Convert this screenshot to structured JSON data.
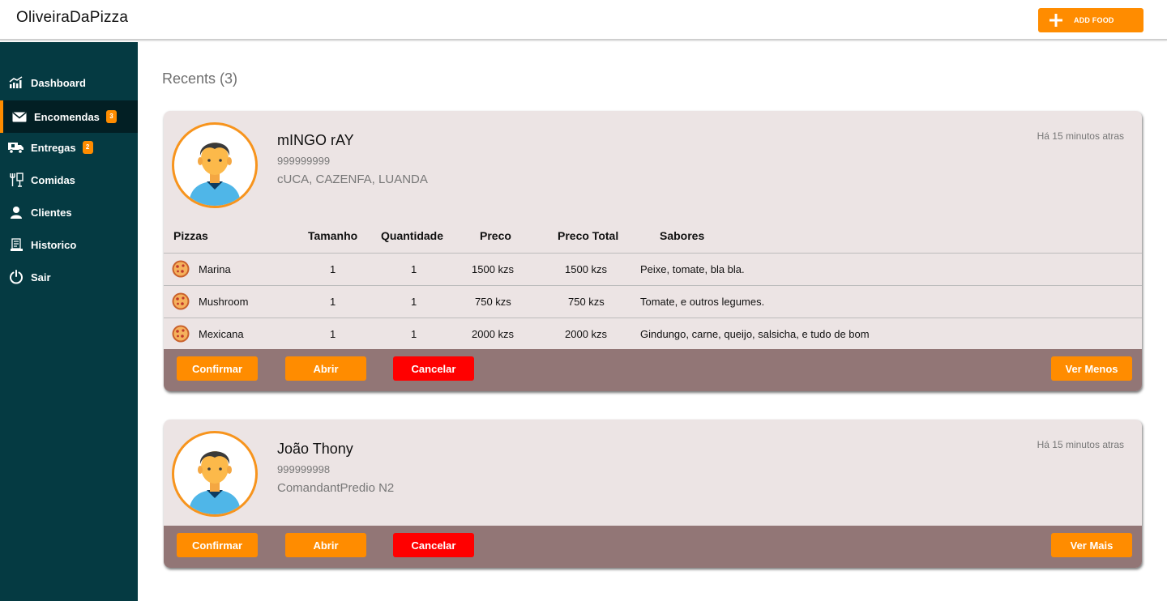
{
  "app": {
    "brand": "OliveiraDaPizza",
    "add_food_label": "ADD FOOD"
  },
  "sidebar": {
    "items": [
      {
        "label": "Dashboard",
        "icon": "chart-icon"
      },
      {
        "label": "Encomendas",
        "icon": "mail-icon",
        "badge": "3",
        "active": true
      },
      {
        "label": "Entregas",
        "icon": "truck-icon",
        "badge": "2"
      },
      {
        "label": "Comidas",
        "icon": "utensils-icon"
      },
      {
        "label": "Clientes",
        "icon": "user-icon"
      },
      {
        "label": "Historico",
        "icon": "history-icon"
      },
      {
        "label": "Sair",
        "icon": "power-icon"
      }
    ]
  },
  "main": {
    "title": "Recents (3)"
  },
  "orders": [
    {
      "name": "mINGO rAY",
      "phone": "999999999",
      "address": "cUCA, CAZENFA, LUANDA",
      "time": "Há 15 minutos atras",
      "columns": [
        "Pizzas",
        "Tamanho",
        "Quantidade",
        "Preco",
        "Preco Total",
        "Sabores"
      ],
      "items": [
        {
          "pizza": "Marina",
          "size": "1",
          "qty": "1",
          "price": "1500 kzs",
          "total": "1500 kzs",
          "flavors": "Peixe, tomate, bla bla."
        },
        {
          "pizza": "Mushroom",
          "size": "1",
          "qty": "1",
          "price": "750 kzs",
          "total": "750 kzs",
          "flavors": "Tomate, e outros legumes."
        },
        {
          "pizza": "Mexicana",
          "size": "1",
          "qty": "1",
          "price": "2000 kzs",
          "total": "2000 kzs",
          "flavors": "Gindungo, carne, queijo, salsicha, e tudo de bom"
        }
      ],
      "buttons": {
        "confirm": "Confirmar",
        "open": "Abrir",
        "cancel": "Cancelar",
        "toggle": "Ver Menos"
      }
    },
    {
      "name": "João Thony",
      "phone": "999999998",
      "address": "ComandantPredio N2",
      "time": "Há 15 minutos atras",
      "buttons": {
        "confirm": "Confirmar",
        "open": "Abrir",
        "cancel": "Cancelar",
        "toggle": "Ver Mais"
      }
    }
  ],
  "colors": {
    "accent": "#ff8c00",
    "sidebar": "#053a42",
    "card": "#ece4e4",
    "action_bar": "#927676",
    "cancel": "#ff0000"
  }
}
